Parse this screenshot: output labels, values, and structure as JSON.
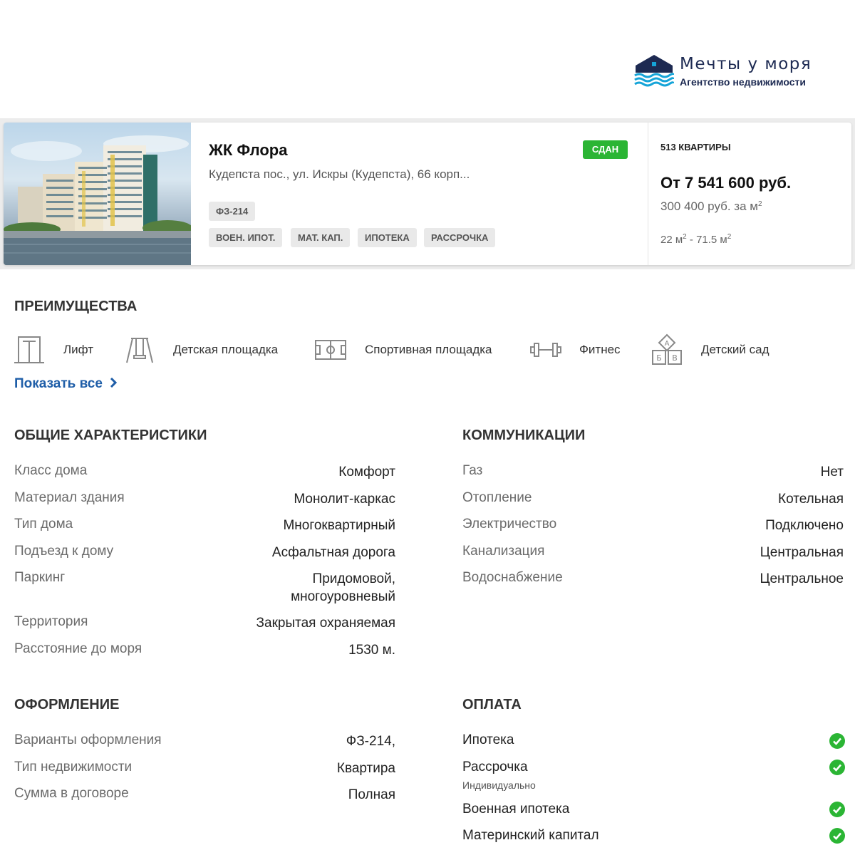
{
  "brand": {
    "name": "Мечты у моря",
    "tagline": "Агентство недвижимости",
    "accent": "#1f5ea8",
    "logo_color": "#1d2a52",
    "wave_color": "#15a4d8"
  },
  "listing": {
    "title": "ЖК Флора",
    "status": "СДАН",
    "status_color": "#2bb534",
    "address": "Кудепста пос., ул. Искры (Кудепста), 66 корп...",
    "law_tag": "ФЗ-214",
    "payment_tags": [
      "ВОЕН. ИПОТ.",
      "МАТ. КАП.",
      "ИПОТЕКА",
      "РАССРОЧКА"
    ],
    "flats_count": "513 КВАРТИРЫ",
    "price": "От 7 541 600 руб.",
    "price_per_m2": "300 400 руб. за м",
    "price_per_m2_sup": "2",
    "area_from": "22 м",
    "area_sep": " - 71.5 м",
    "area_sup": "2"
  },
  "advantages": {
    "title": "ПРЕИМУЩЕСТВА",
    "items": [
      {
        "label": "Лифт",
        "icon": "elevator-icon"
      },
      {
        "label": "Детская площадка",
        "icon": "swing-icon"
      },
      {
        "label": "Спортивная площадка",
        "icon": "sports-field-icon"
      },
      {
        "label": "Фитнес",
        "icon": "dumbbell-icon"
      },
      {
        "label": "Детский сад",
        "icon": "abc-blocks-icon"
      }
    ],
    "show_all": "Показать все"
  },
  "general": {
    "title": "ОБЩИЕ ХАРАКТЕРИСТИКИ",
    "rows": [
      {
        "label": "Класс дома",
        "value": "Комфорт"
      },
      {
        "label": "Материал здания",
        "value": "Монолит-каркас"
      },
      {
        "label": "Тип дома",
        "value": "Многоквартирный"
      },
      {
        "label": "Подъезд к дому",
        "value": "Асфальтная дорога"
      },
      {
        "label": "Паркинг",
        "value": "Придомовой,",
        "value2": "многоуровневый"
      },
      {
        "label": "Территория",
        "value": "Закрытая охраняемая"
      },
      {
        "label": "Расстояние до моря",
        "value": "1530 м."
      }
    ]
  },
  "communications": {
    "title": "КОММУНИКАЦИИ",
    "rows": [
      {
        "label": "Газ",
        "value": "Нет"
      },
      {
        "label": "Отопление",
        "value": "Котельная"
      },
      {
        "label": "Электричество",
        "value": "Подключено"
      },
      {
        "label": "Канализация",
        "value": "Центральная"
      },
      {
        "label": "Водоснабжение",
        "value": "Центральное"
      }
    ]
  },
  "registration": {
    "title": "ОФОРМЛЕНИЕ",
    "rows": [
      {
        "label": "Варианты оформления",
        "value": "ФЗ-214,"
      },
      {
        "label": "Тип недвижимости",
        "value": "Квартира"
      },
      {
        "label": "Сумма в договоре",
        "value": "Полная"
      }
    ]
  },
  "payment": {
    "title": "ОПЛАТА",
    "check_color": "#2bb534",
    "rows": [
      {
        "label": "Ипотека",
        "available": true
      },
      {
        "label": "Рассрочка",
        "note": "Индивидуально",
        "available": true
      },
      {
        "label": "Военная ипотека",
        "available": true
      },
      {
        "label": "Материнский капитал",
        "available": true
      }
    ]
  }
}
